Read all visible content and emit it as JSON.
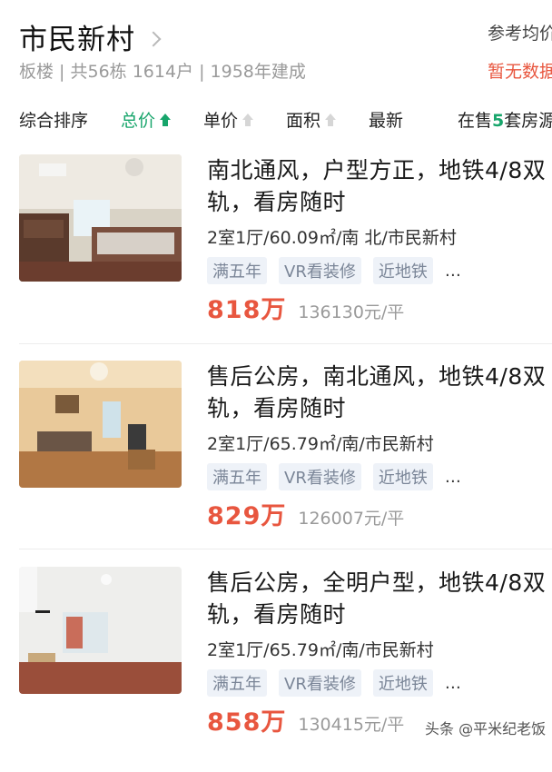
{
  "header": {
    "title": "市民新村",
    "subtitle": "板楼 | 共56栋 1614户 | 1958年建成",
    "ref_label": "参考均价",
    "no_data": "暂无数据"
  },
  "sortbar": {
    "items": [
      "综合排序",
      "总价",
      "单价",
      "面积",
      "最新"
    ],
    "on_sale_prefix": "在售",
    "on_sale_count": "5",
    "on_sale_suffix": "套房源"
  },
  "listings": [
    {
      "title": "南北通风，户型方正，地铁4/8双轨，看房随时",
      "meta": "2室1厅/60.09㎡/南 北/市民新村",
      "tags": [
        "满五年",
        "VR看装修",
        "近地铁"
      ],
      "more": "…",
      "price": "818万",
      "unit_price": "136130元/平"
    },
    {
      "title": "售后公房，南北通风，地铁4/8双轨，看房随时",
      "meta": "2室1厅/65.79㎡/南/市民新村",
      "tags": [
        "满五年",
        "VR看装修",
        "近地铁"
      ],
      "more": "…",
      "price": "829万",
      "unit_price": "126007元/平"
    },
    {
      "title": "售后公房，全明户型，地铁4/8双轨，看房随时",
      "meta": "2室1厅/65.79㎡/南/市民新村",
      "tags": [
        "满五年",
        "VR看装修",
        "近地铁"
      ],
      "more": "…",
      "price": "858万",
      "unit_price": "130415元/平"
    }
  ],
  "watermark": "头条 @平米纪老饭",
  "colors": {
    "accent_green": "#17a56b",
    "price_red": "#e8563f",
    "tag_bg": "#eef2f8"
  }
}
